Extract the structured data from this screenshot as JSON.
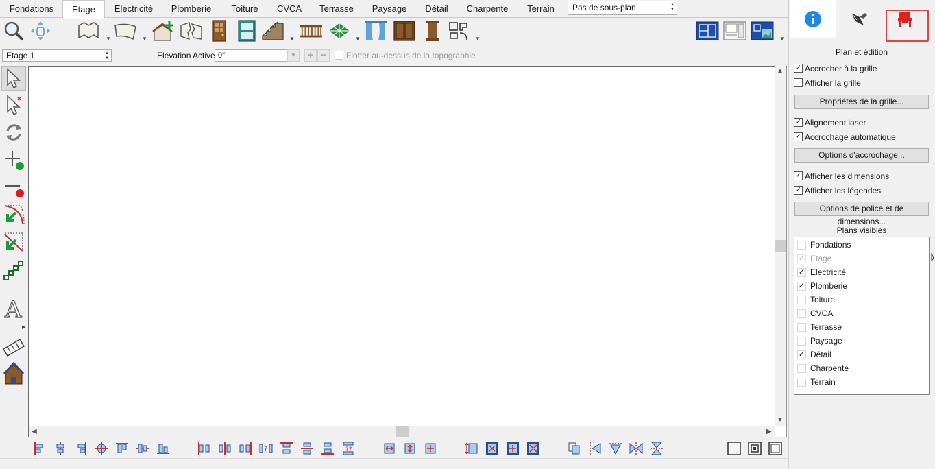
{
  "tabs": [
    {
      "label": "Fondations"
    },
    {
      "label": "Etage"
    },
    {
      "label": "Electricité"
    },
    {
      "label": "Plomberie"
    },
    {
      "label": "Toiture"
    },
    {
      "label": "CVCA"
    },
    {
      "label": "Terrasse"
    },
    {
      "label": "Paysage"
    },
    {
      "label": "Détail"
    },
    {
      "label": "Charpente"
    },
    {
      "label": "Terrain"
    }
  ],
  "active_tab": "Etage",
  "subplan_select": {
    "value": "Pas de sous-plan"
  },
  "floor_select": {
    "value": "Etage 1"
  },
  "elevation": {
    "label": "Elévation Active:",
    "value": "0\""
  },
  "float_above_topo": {
    "label": "Flotter au-dessus de la topographie",
    "checked": false
  },
  "right_panel": {
    "section_title": "Plan et édition",
    "snap_grid": {
      "label": "Accrocher à la grille",
      "checked": true
    },
    "show_grid": {
      "label": "Afficher la grille",
      "checked": false
    },
    "grid_props_button": "Propriétés de la grille...",
    "laser_align": {
      "label": "Alignement laser",
      "checked": true
    },
    "auto_snap": {
      "label": "Accrochage automatique",
      "checked": true
    },
    "snap_options_button": "Options d'accrochage...",
    "show_dimensions": {
      "label": "Afficher les dimensions",
      "checked": true
    },
    "show_legends": {
      "label": "Afficher les légendes",
      "checked": true
    },
    "font_dim_button": "Options de police et de dimensions...",
    "visible_plans_title": "Plans visibles",
    "visible_plans": [
      {
        "label": "Fondations",
        "checked": false
      },
      {
        "label": "Etage",
        "checked": true,
        "disabled": true
      },
      {
        "label": "Electricité",
        "checked": true
      },
      {
        "label": "Plomberie",
        "checked": true
      },
      {
        "label": "Toiture",
        "checked": false
      },
      {
        "label": "CVCA",
        "checked": false
      },
      {
        "label": "Terrasse",
        "checked": false
      },
      {
        "label": "Paysage",
        "checked": false
      },
      {
        "label": "Détail",
        "checked": true
      },
      {
        "label": "Charpente",
        "checked": false
      },
      {
        "label": "Terrain",
        "checked": false
      }
    ]
  },
  "colors": {
    "accent_blue": "#1e88e5",
    "highlight_red": "#e04545",
    "wood_brown": "#8a5a2b",
    "teal": "#2b8a8a"
  }
}
